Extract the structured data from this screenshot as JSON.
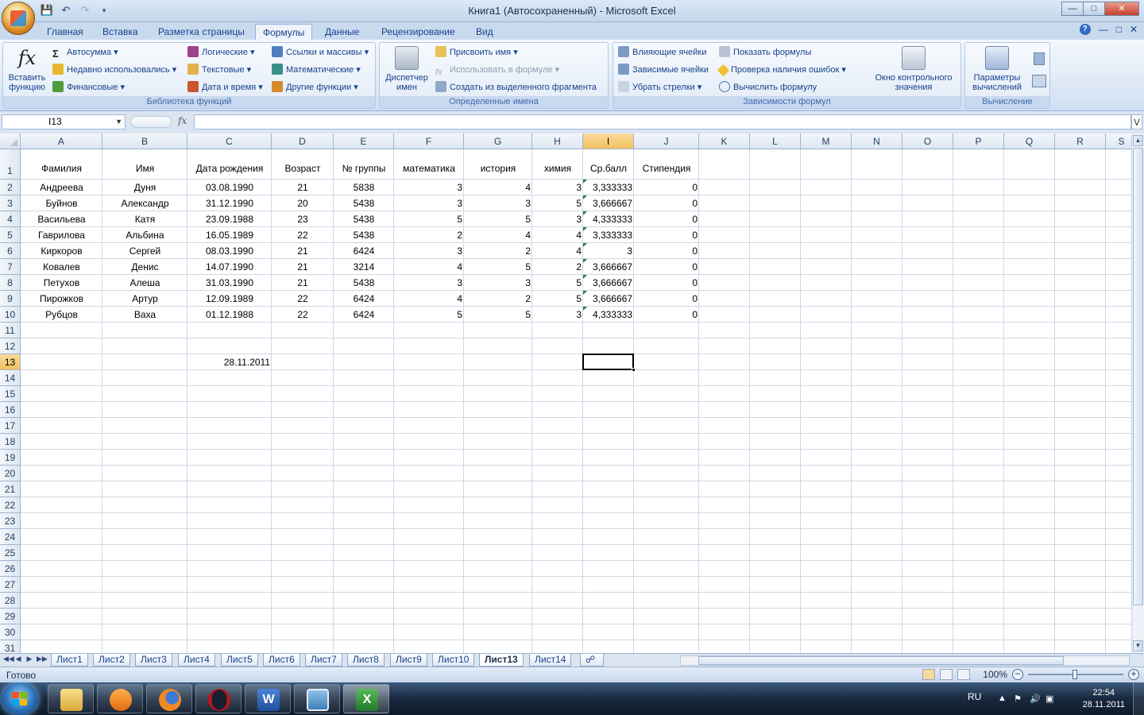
{
  "window": {
    "title": "Книга1 (Автосохраненный) - Microsoft Excel"
  },
  "ribbon_tabs": [
    "Главная",
    "Вставка",
    "Разметка страницы",
    "Формулы",
    "Данные",
    "Рецензирование",
    "Вид"
  ],
  "active_tab": "Формулы",
  "ribbon": {
    "function_library": {
      "insert_function": "Вставить функцию",
      "insert_function_l1": "Вставить",
      "insert_function_l2": "функцию",
      "autosum": "Автосумма",
      "recent": "Недавно использовались",
      "financial": "Финансовые",
      "logical": "Логические",
      "text": "Текстовые",
      "datetime": "Дата и время",
      "lookup": "Ссылки и массивы",
      "math": "Математические",
      "other": "Другие функции",
      "label": "Библиотека функций"
    },
    "defined_names": {
      "manager_l1": "Диспетчер",
      "manager_l2": "имен",
      "define_name": "Присвоить имя",
      "use_in_formula": "Использовать в формуле",
      "create_from_selection": "Создать из выделенного фрагмента",
      "label": "Определенные имена"
    },
    "formula_auditing": {
      "trace_precedents": "Влияющие ячейки",
      "trace_dependents": "Зависимые ячейки",
      "remove_arrows": "Убрать стрелки",
      "show_formulas": "Показать формулы",
      "error_checking": "Проверка наличия ошибок",
      "evaluate_formula": "Вычислить формулу",
      "watch_window_l1": "Окно контрольного",
      "watch_window_l2": "значения",
      "label": "Зависимости формул"
    },
    "calculation": {
      "options_l1": "Параметры",
      "options_l2": "вычислений",
      "label": "Вычисление"
    }
  },
  "formula_bar": {
    "name_box": "I13",
    "fx_symbol": "fx",
    "formula": ""
  },
  "columns": [
    "A",
    "B",
    "C",
    "D",
    "E",
    "F",
    "G",
    "H",
    "I",
    "J",
    "K",
    "L",
    "M",
    "N",
    "O",
    "P",
    "Q",
    "R",
    "S"
  ],
  "selected_column": "I",
  "selected_row": "13",
  "row_numbers": [
    "1",
    "2",
    "3",
    "4",
    "5",
    "6",
    "7",
    "8",
    "9",
    "10",
    "11",
    "12",
    "13",
    "14",
    "15",
    "16",
    "17",
    "18",
    "19",
    "20",
    "21",
    "22",
    "23",
    "24",
    "25",
    "26",
    "27",
    "28",
    "29",
    "30",
    "31"
  ],
  "table": {
    "headers": [
      "Фамилия",
      "Имя",
      "Дата рождения",
      "Возраст",
      "№ группы",
      "математика",
      "история",
      "химия",
      "Ср.балл",
      "Стипендия"
    ],
    "rows": [
      [
        "Андреева",
        "Дуня",
        "03.08.1990",
        "21",
        "5838",
        "3",
        "4",
        "3",
        "3,333333",
        "0"
      ],
      [
        "Буйнов",
        "Александр",
        "31.12.1990",
        "20",
        "5438",
        "3",
        "3",
        "5",
        "3,666667",
        "0"
      ],
      [
        "Васильева",
        "Катя",
        "23.09.1988",
        "23",
        "5438",
        "5",
        "5",
        "3",
        "4,333333",
        "0"
      ],
      [
        "Гаврилова",
        "Альбина",
        "16.05.1989",
        "22",
        "5438",
        "2",
        "4",
        "4",
        "3,333333",
        "0"
      ],
      [
        "Киркоров",
        "Сергей",
        "08.03.1990",
        "21",
        "6424",
        "3",
        "2",
        "4",
        "3",
        "0"
      ],
      [
        "Ковалев",
        "Денис",
        "14.07.1990",
        "21",
        "3214",
        "4",
        "5",
        "2",
        "3,666667",
        "0"
      ],
      [
        "Петухов",
        "Алеша",
        "31.03.1990",
        "21",
        "5438",
        "3",
        "3",
        "5",
        "3,666667",
        "0"
      ],
      [
        "Пирожков",
        "Артур",
        "12.09.1989",
        "22",
        "6424",
        "4",
        "2",
        "5",
        "3,666667",
        "0"
      ],
      [
        "Рубцов",
        "Ваха",
        "01.12.1988",
        "22",
        "6424",
        "5",
        "5",
        "3",
        "4,333333",
        "0"
      ]
    ],
    "c13_value": "28.11.2011"
  },
  "sheet_tabs": [
    "Лист1",
    "Лист2",
    "Лист3",
    "Лист4",
    "Лист5",
    "Лист6",
    "Лист7",
    "Лист8",
    "Лист9",
    "Лист10",
    "Лист13",
    "Лист14"
  ],
  "active_sheet": "Лист13",
  "status": {
    "ready": "Готово",
    "zoom": "100%"
  },
  "taskbar": {
    "lang": "RU",
    "time": "22:54",
    "date": "28.11.2011"
  }
}
